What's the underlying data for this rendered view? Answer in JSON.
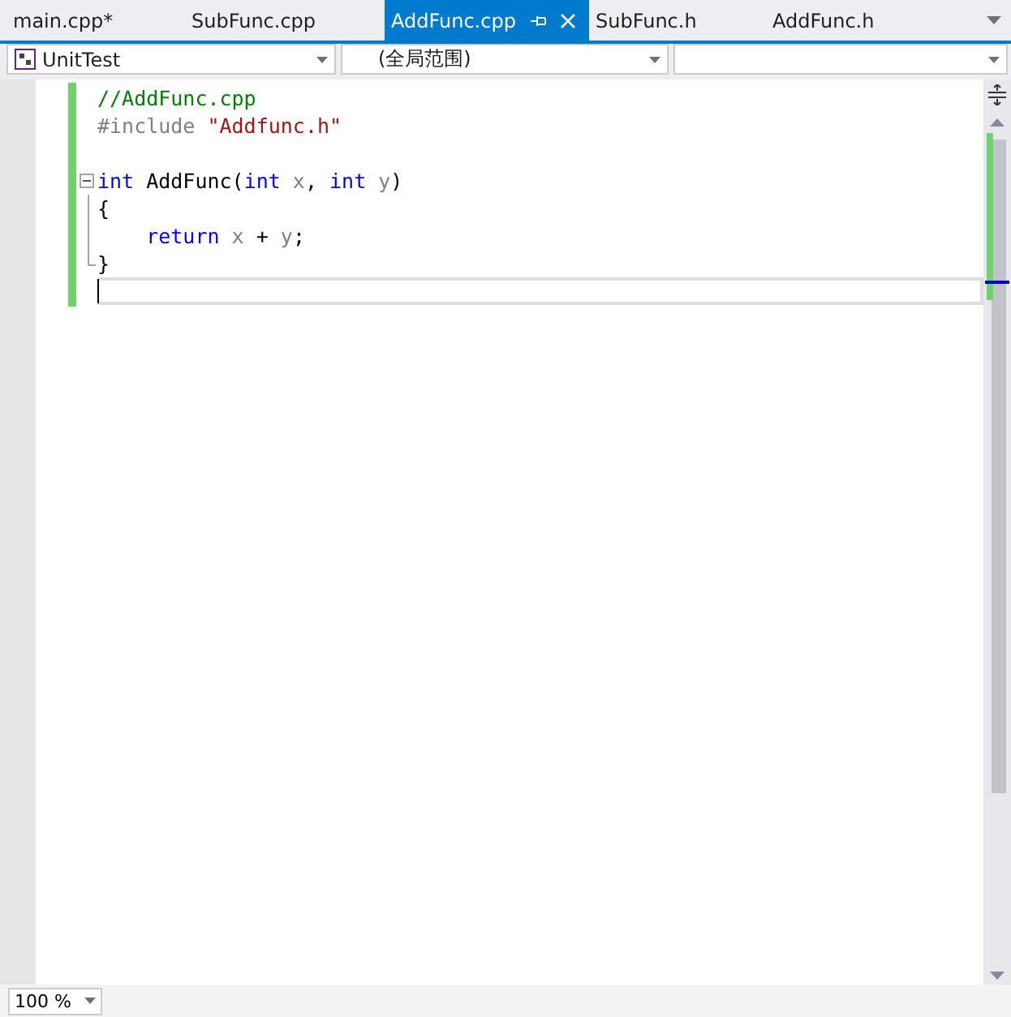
{
  "tabs": [
    {
      "label": "main.cpp*",
      "selected": false
    },
    {
      "label": "SubFunc.cpp",
      "selected": false
    },
    {
      "label": "AddFunc.cpp",
      "selected": true
    },
    {
      "label": "SubFunc.h",
      "selected": false
    },
    {
      "label": "AddFunc.h",
      "selected": false
    }
  ],
  "navbar": {
    "project": "UnitTest",
    "scope": "(全局范围)"
  },
  "code_lines": [
    {
      "current": false,
      "tokens": [
        {
          "text": "//AddFunc.cpp",
          "kind": "comment"
        }
      ]
    },
    {
      "current": false,
      "tokens": [
        {
          "text": "#include ",
          "kind": "preproc"
        },
        {
          "text": "\"Addfunc.h\"",
          "kind": "string"
        }
      ]
    },
    {
      "current": false
    },
    {
      "current": false,
      "fold_start": true,
      "tokens": [
        {
          "text": "int",
          "kind": "keyword"
        },
        {
          "text": " AddFunc(",
          "kind": "plain"
        },
        {
          "text": "int",
          "kind": "keyword"
        },
        {
          "text": " x",
          "kind": "param"
        },
        {
          "text": ", ",
          "kind": "plain"
        },
        {
          "text": "int",
          "kind": "keyword"
        },
        {
          "text": " y",
          "kind": "param"
        },
        {
          "text": ")",
          "kind": "plain"
        }
      ]
    },
    {
      "current": false,
      "tokens": [
        {
          "text": "{",
          "kind": "plain"
        }
      ]
    },
    {
      "current": false,
      "tokens": [
        {
          "text": "    return",
          "kind": "keyword"
        },
        {
          "text": " x",
          "kind": "param"
        },
        {
          "text": " + ",
          "kind": "plain"
        },
        {
          "text": "y",
          "kind": "param"
        },
        {
          "text": ";",
          "kind": "plain"
        }
      ]
    },
    {
      "current": false,
      "tokens": [
        {
          "text": "}",
          "kind": "plain"
        }
      ]
    },
    {
      "current": true
    }
  ],
  "zoom": "100 %"
}
